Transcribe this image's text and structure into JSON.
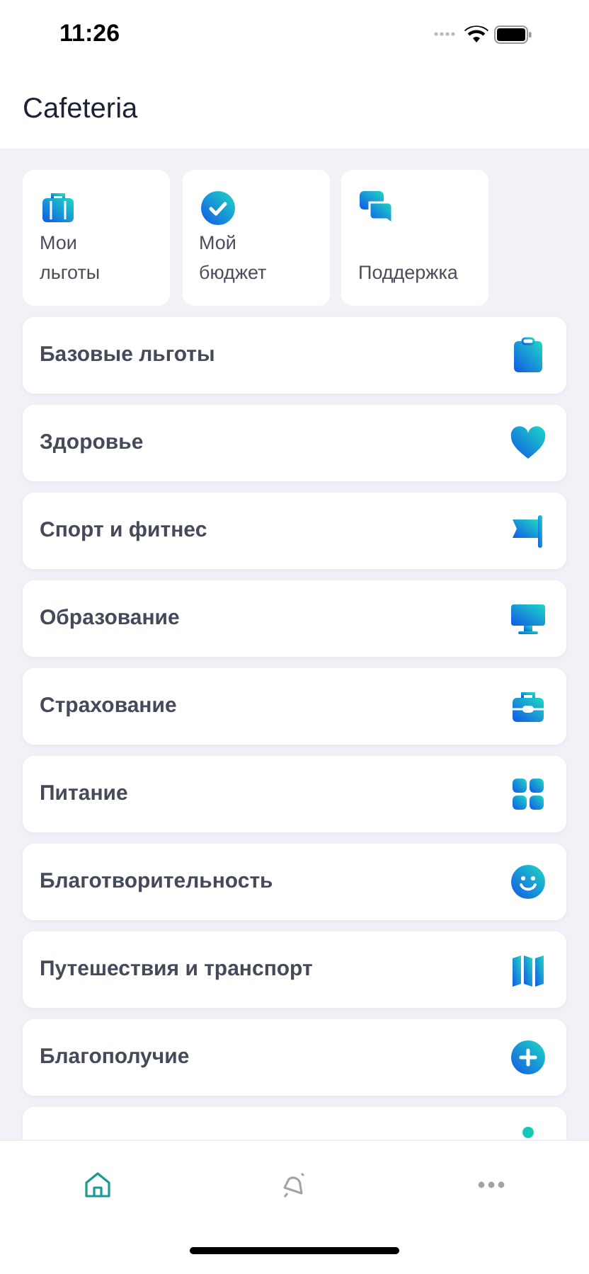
{
  "status_bar": {
    "time": "11:26"
  },
  "header": {
    "title": "Cafeteria"
  },
  "shortcuts": [
    {
      "label": "Мои льготы"
    },
    {
      "label": "Мой бюджет"
    },
    {
      "label": "Поддержка"
    }
  ],
  "categories": [
    {
      "label": "Базовые льготы"
    },
    {
      "label": "Здоровье"
    },
    {
      "label": "Спорт и фитнес"
    },
    {
      "label": "Образование"
    },
    {
      "label": "Страхование"
    },
    {
      "label": "Питание"
    },
    {
      "label": "Благотворительность"
    },
    {
      "label": "Путешествия и транспорт"
    },
    {
      "label": "Благополучие"
    }
  ],
  "tab_bar": [
    {
      "kind": "home",
      "selected": true
    },
    {
      "kind": "notifications",
      "selected": false
    },
    {
      "kind": "more",
      "selected": false
    }
  ]
}
